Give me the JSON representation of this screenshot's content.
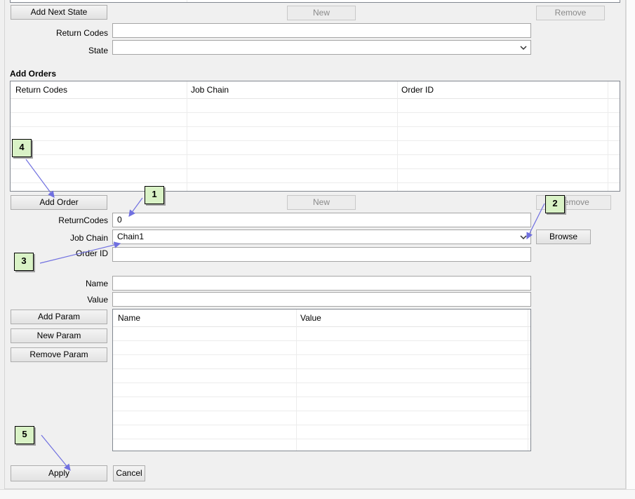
{
  "states": {
    "add_next_state_label": "Add Next State",
    "new_label": "New",
    "remove_label": "Remove",
    "return_codes_label": "Return Codes",
    "return_codes_value": "",
    "state_label": "State",
    "state_value": ""
  },
  "orders": {
    "section_title": "Add Orders",
    "columns": [
      "Return Codes",
      "Job Chain",
      "Order ID"
    ],
    "add_order_label": "Add Order",
    "new_label": "New",
    "remove_label": "Remove",
    "return_codes_label": "ReturnCodes",
    "return_codes_value": "0",
    "job_chain_label": "Job Chain",
    "job_chain_value": "Chain1",
    "browse_label": "Browse",
    "order_id_label": "Order ID",
    "order_id_value": ""
  },
  "params": {
    "name_label": "Name",
    "name_value": "",
    "value_label": "Value",
    "value_value": "",
    "add_param_label": "Add Param",
    "new_param_label": "New Param",
    "remove_param_label": "Remove Param",
    "columns": [
      "Name",
      "Value"
    ]
  },
  "footer": {
    "apply_label": "Apply",
    "cancel_label": "Cancel"
  },
  "callouts": [
    "1",
    "2",
    "3",
    "4",
    "5"
  ],
  "colors": {
    "callout_fill": "#d9f2c6",
    "arrow": "#7070e0",
    "window_bg": "#f0f0f0"
  }
}
